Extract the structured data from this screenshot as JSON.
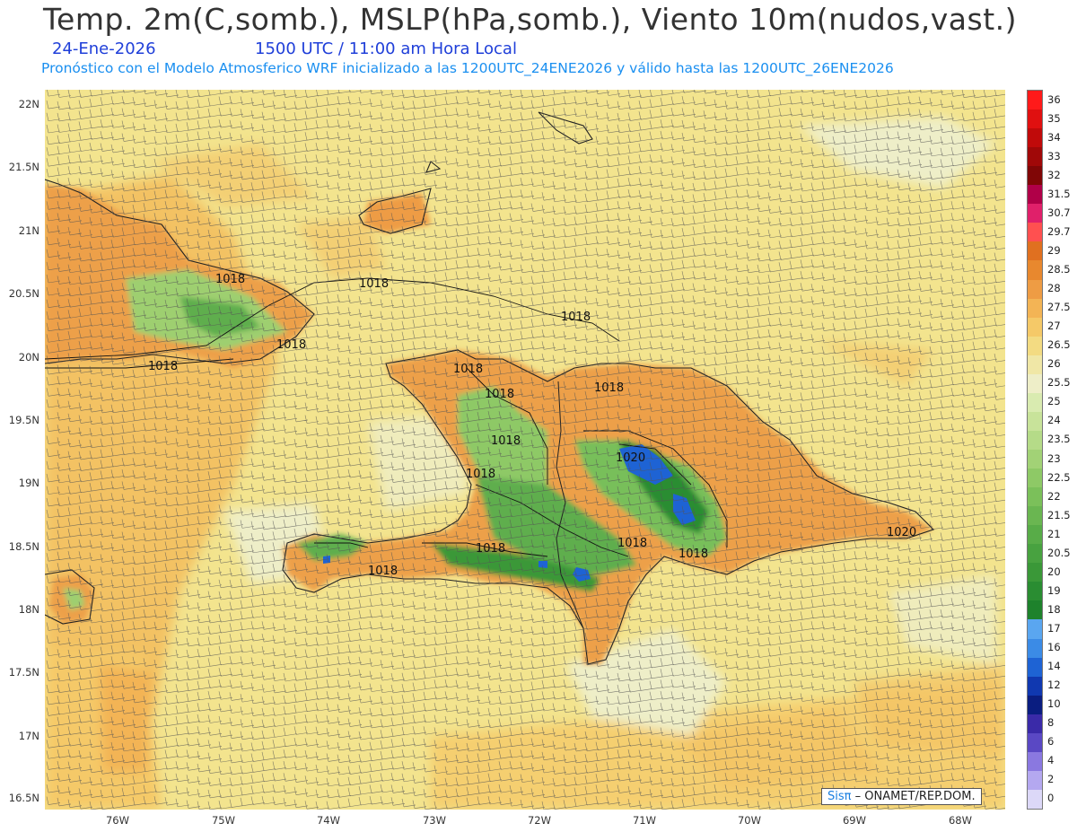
{
  "title": "Temp. 2m(C,somb.), MSLP(hPa,somb.), Viento 10m(nudos,vast.)",
  "date": "24-Ene-2026",
  "valid_time": "1500 UTC / 11:00 am Hora Local",
  "model_info": "Pronóstico con el Modelo Atmosferico WRF inicializado a las 1200UTC_24ENE2026 y válido hasta las  1200UTC_26ENE2026",
  "lat_labels": [
    "22N",
    "21.5N",
    "21N",
    "20.5N",
    "20N",
    "19.5N",
    "19N",
    "18.5N",
    "18N",
    "17.5N",
    "17N",
    "16.5N"
  ],
  "lon_labels": [
    "76W",
    "75W",
    "74W",
    "73W",
    "72W",
    "71W",
    "70W",
    "69W",
    "68W"
  ],
  "colorbar": {
    "labels": [
      "36",
      "35",
      "34",
      "33",
      "32",
      "31.5",
      "30.7",
      "29.7",
      "29",
      "28.5",
      "28",
      "27.5",
      "27",
      "26.5",
      "26",
      "25.5",
      "25",
      "24",
      "23.5",
      "23",
      "22.5",
      "22",
      "21.5",
      "21",
      "20.5",
      "20",
      "19",
      "18",
      "17",
      "16",
      "14",
      "12",
      "10",
      "8",
      "6",
      "4",
      "2",
      "0"
    ],
    "colors": [
      "#ff1a1a",
      "#e01010",
      "#c00a0a",
      "#a00808",
      "#800606",
      "#b00048",
      "#e0206a",
      "#ff5050",
      "#e07020",
      "#e8882e",
      "#ee9c44",
      "#f3b455",
      "#f5c968",
      "#f3db82",
      "#f0e7a6",
      "#eeeec8",
      "#d9ebb0",
      "#c8e39a",
      "#b5db88",
      "#a2d276",
      "#8ec966",
      "#7bc05a",
      "#6ab651",
      "#58ac48",
      "#48a240",
      "#3a9838",
      "#2a8d32",
      "#1e822c",
      "#5aa6f0",
      "#3b8be6",
      "#1e63d4",
      "#1038b0",
      "#0a1d80",
      "#3a2aa8",
      "#5a48c4",
      "#8a78e0",
      "#b4a8f0",
      "#dcd8f8"
    ]
  },
  "pressure_labels": [
    "1018",
    "1018",
    "1018",
    "1018",
    "1018",
    "1018",
    "1018",
    "1018",
    "1018",
    "1018",
    "1018",
    "1018",
    "1018",
    "1018",
    "1020"
  ],
  "credit": {
    "prefix": "Sis",
    "pi": "π",
    "suffix": "– ONAMET/REP.DOM."
  }
}
